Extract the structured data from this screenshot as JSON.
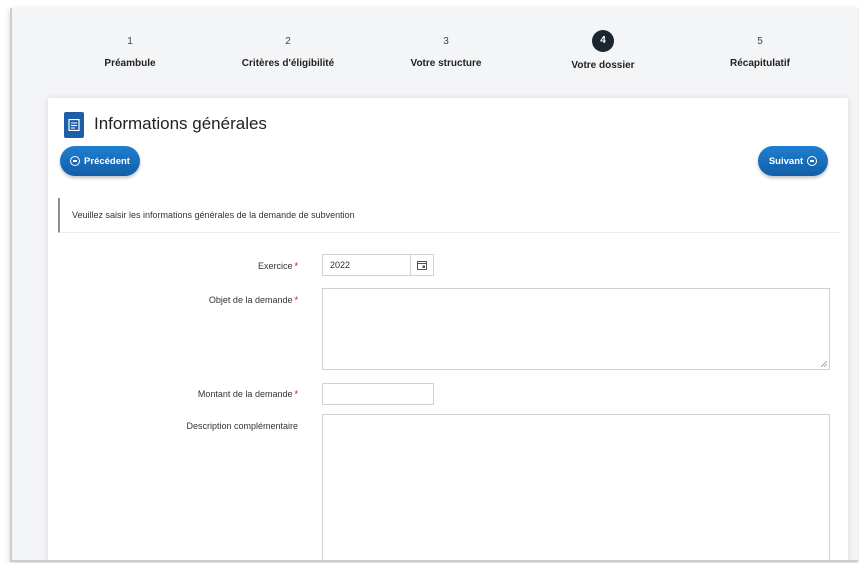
{
  "stepper": {
    "steps": [
      {
        "number": "1",
        "label": "Préambule"
      },
      {
        "number": "2",
        "label": "Critères d'éligibilité"
      },
      {
        "number": "3",
        "label": "Votre structure"
      },
      {
        "number": "4",
        "label": "Votre dossier"
      },
      {
        "number": "5",
        "label": "Récapitulatif"
      }
    ],
    "active_step": "4"
  },
  "page": {
    "title": "Informations générales"
  },
  "nav": {
    "prev_label": "Précédent",
    "next_label": "Suivant"
  },
  "info": {
    "text": "Veuillez saisir les informations générales de la demande de subvention"
  },
  "form": {
    "exercice": {
      "label": "Exercice",
      "value": "2022",
      "required_mark": "*"
    },
    "objet": {
      "label": "Objet de la demande",
      "value": "",
      "required_mark": "*"
    },
    "montant": {
      "label": "Montant de la demande",
      "value": "",
      "required_mark": "*"
    },
    "description": {
      "label": "Description complémentaire",
      "value": ""
    }
  },
  "colors": {
    "primary": "#1d5fa6",
    "active_step": "#1b2630",
    "required": "#d0021b"
  },
  "icons": {
    "title": "document-icon",
    "prev": "arrow-circle-left-icon",
    "next": "arrow-circle-right-icon",
    "calendar": "calendar-icon"
  }
}
